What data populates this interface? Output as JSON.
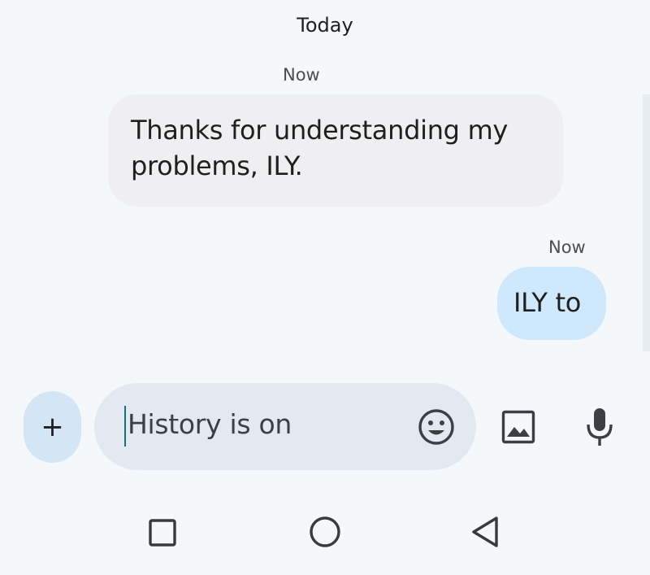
{
  "conversation": {
    "date_header": "Today",
    "messages": [
      {
        "direction": "incoming",
        "timestamp": "Now",
        "line1": "Thanks for understanding my",
        "line2": "problems, ILY."
      },
      {
        "direction": "outgoing",
        "timestamp": "Now",
        "text": "ILY to"
      }
    ]
  },
  "composer": {
    "add_label": "+",
    "placeholder": "History is on",
    "icons": [
      "plus-icon",
      "emoji-icon",
      "image-icon",
      "microphone-icon"
    ]
  },
  "navbar": {
    "icons": [
      "recents-square-icon",
      "home-circle-icon",
      "back-triangle-icon"
    ]
  },
  "colors": {
    "background": "#f4f8fb",
    "incoming_bubble": "#efeff1",
    "outgoing_bubble": "#cfe8fb",
    "input_pill": "#e2e9f1",
    "plus_button": "#d4e6f6",
    "caret": "#1b6e7a"
  }
}
